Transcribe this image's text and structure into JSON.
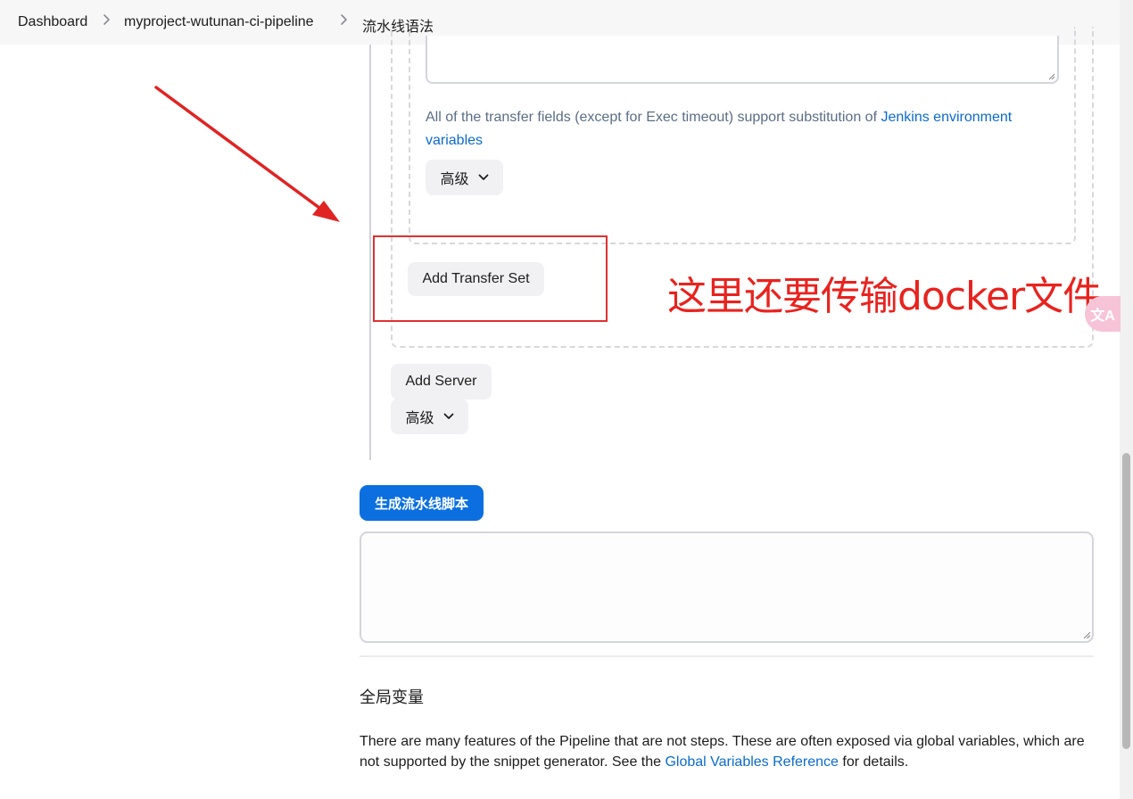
{
  "breadcrumb": {
    "items": [
      "Dashboard",
      "myproject-wutunan-ci-pipeline",
      "流水线语法"
    ]
  },
  "transfer": {
    "help_prefix": "All of the transfer fields (except for Exec timeout) support substitution of ",
    "help_link": "Jenkins environment variables",
    "advanced_label": "高级",
    "add_transfer_set_label": "Add Transfer Set"
  },
  "server": {
    "add_server_label": "Add Server",
    "advanced_label": "高级"
  },
  "generate": {
    "button_label": "生成流水线脚本",
    "output_value": ""
  },
  "global_vars": {
    "heading": "全局变量",
    "desc_prefix": "There are many features of the Pipeline that are not steps. These are often exposed via global variables, which are not supported by the snippet generator. See the ",
    "desc_link": "Global Variables Reference",
    "desc_suffix": " for details."
  },
  "annotation": {
    "text": "这里还要传输docker文件",
    "color": "#e8231f"
  },
  "translate_widget": {
    "label": "文A"
  },
  "colors": {
    "primary": "#0b6fe0",
    "link": "#0b6bcb",
    "annotation": "#e03131"
  }
}
